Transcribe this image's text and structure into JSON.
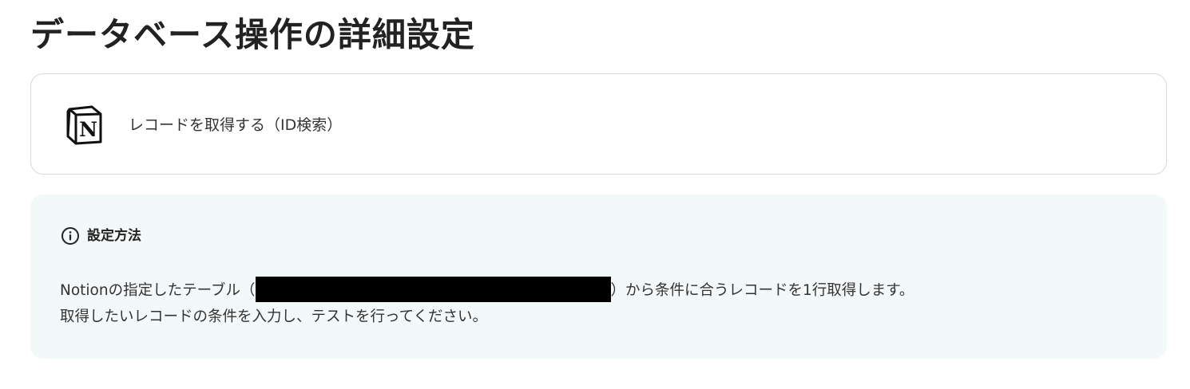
{
  "page": {
    "title": "データベース操作の詳細設定"
  },
  "action": {
    "app_icon": "notion-icon",
    "label": "レコードを取得する（ID検索）"
  },
  "info": {
    "icon": "info-icon",
    "heading": "設定方法",
    "line1_prefix": "Notionの指定したテーブル（",
    "line1_suffix": "）から条件に合うレコードを1行取得します。",
    "line2": "取得したいレコードの条件を入力し、テストを行ってください。"
  }
}
